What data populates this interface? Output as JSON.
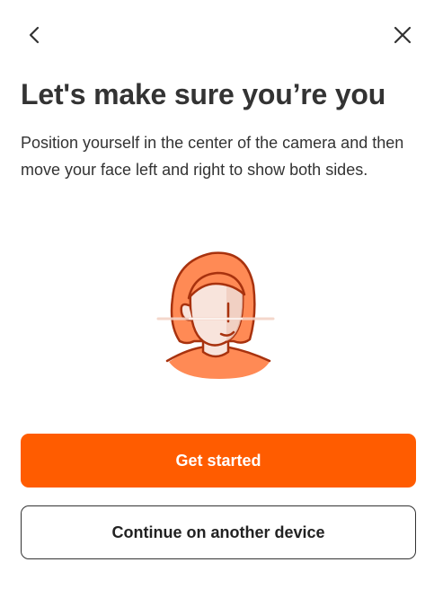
{
  "header": {
    "back_icon": "chevron-left-icon",
    "close_icon": "close-icon"
  },
  "main": {
    "title": "Let's make sure you’re you",
    "description": "Position yourself in the center of the camera and then move your face left and right to show both sides.",
    "illustration_icon": "face-scan-illustration"
  },
  "actions": {
    "primary_label": "Get started",
    "secondary_label": "Continue on another device"
  },
  "colors": {
    "accent": "#ff5c00",
    "text": "#333333",
    "hair": "#ff8a55",
    "outline": "#a8320e",
    "skin": "#f8e4dc"
  }
}
